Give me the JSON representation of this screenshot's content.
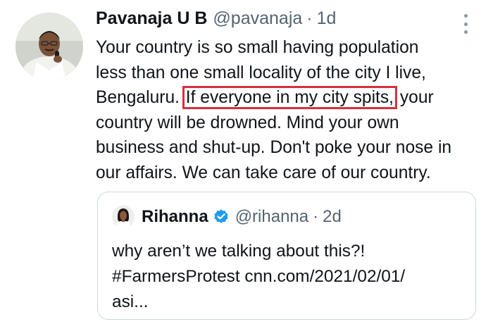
{
  "tweet": {
    "author_name": "Pavanaja U B",
    "author_handle": "@pavanaja",
    "separator": "·",
    "time": "1d",
    "more_icon": "more-vertical-icon",
    "avatar_icon": "profile-photo",
    "text_lines": [
      "Your country is so small having population",
      "less than one small locality of the city I live,",
      "Bengaluru. ",
      "If everyone in my city spits,",
      " your",
      "country will be drowned. Mind your own",
      "business and shut-up. Don't poke your nose in",
      "our affairs. We can take care of our country."
    ],
    "highlight_color": "#d6303d"
  },
  "quoted_tweet": {
    "author_name": "Rihanna",
    "verified_icon": "verified-badge-icon",
    "verified_color": "#1d9bf0",
    "author_handle": "@rihanna",
    "separator": "·",
    "time": "2d",
    "text_lines": [
      "why aren’t we talking about this?!",
      "#FarmersProtest cnn.com/2021/02/01/",
      "asi..."
    ]
  }
}
